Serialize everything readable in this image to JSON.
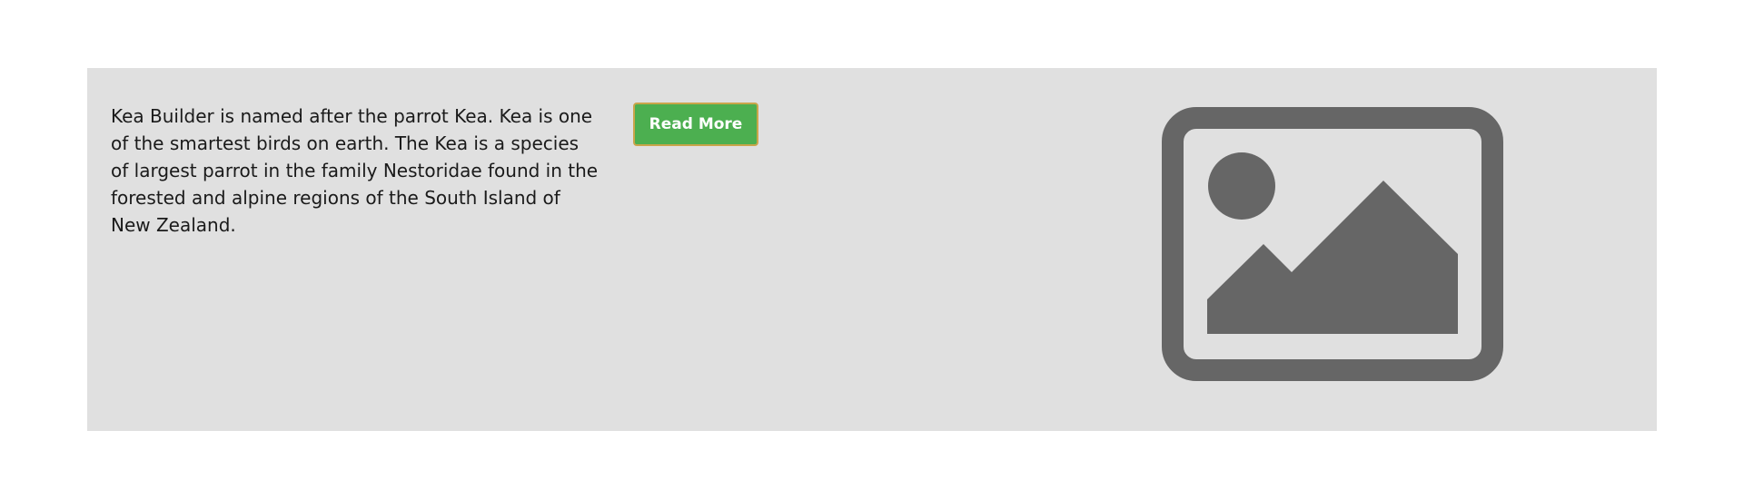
{
  "content": {
    "description": "Kea Builder is named after the parrot Kea. Kea is one of the smartest birds on earth. The Kea is a species of largest parrot in the family Nestoridae found in the forested and alpine regions of the South Island of New Zealand.",
    "read_more_label": "Read More"
  },
  "image": {
    "icon": "image-placeholder-icon"
  },
  "colors": {
    "panel_background": "#e0e0e0",
    "button_background": "#4caf50",
    "button_border": "#c9a54a",
    "icon_fill": "#666666"
  }
}
